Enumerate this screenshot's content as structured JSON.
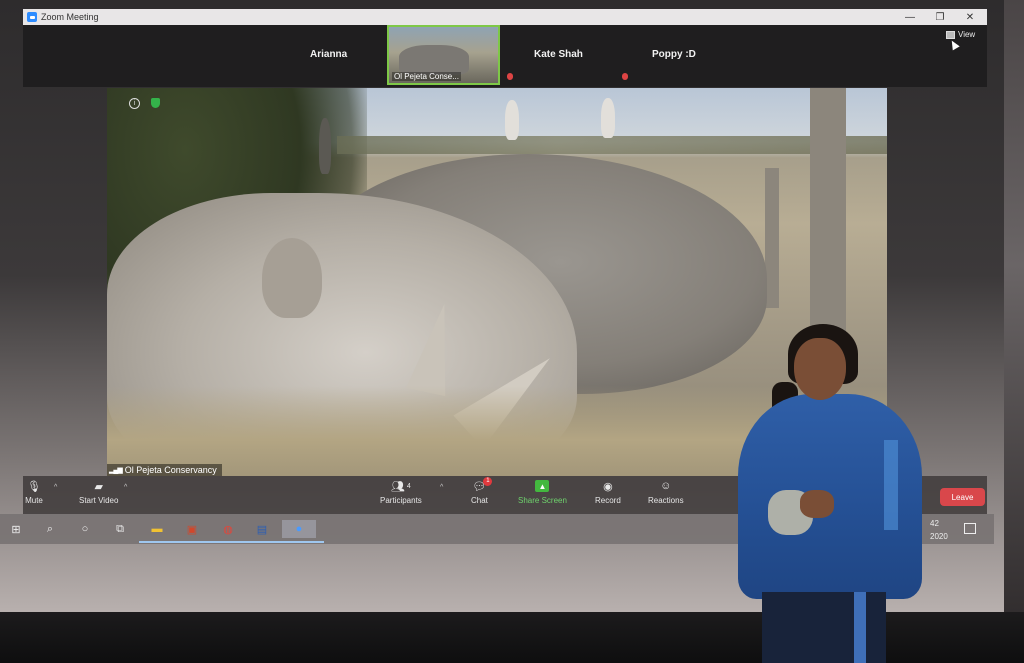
{
  "window": {
    "title": "Zoom Meeting",
    "controls": [
      "—",
      "❐",
      "✕"
    ]
  },
  "participants": [
    {
      "name": "Arianna",
      "muted": false
    },
    {
      "name": "Ol Pejeta Conse...",
      "muted": true,
      "thumbnail": true
    },
    {
      "name": "Kate Shah",
      "muted": false
    },
    {
      "name": "Poppy :D",
      "muted": true
    }
  ],
  "view_button": "View",
  "main_video": {
    "label": "Ol Pejeta Conservancy"
  },
  "toolbar": {
    "mute": "Mute",
    "start_video": "Start Video",
    "participants": "Participants",
    "participants_count": "4",
    "chat": "Chat",
    "chat_badge": "1",
    "share_screen": "Share Screen",
    "record": "Record",
    "reactions": "Reactions",
    "leave": "Leave"
  },
  "taskbar": {
    "time_partial": "42",
    "date_partial": "2020"
  },
  "colors": {
    "zoom_blue": "#2d8cff",
    "share_green": "#43b83f",
    "leave_red": "#d9474b",
    "active_speaker_border": "#7ec847"
  }
}
